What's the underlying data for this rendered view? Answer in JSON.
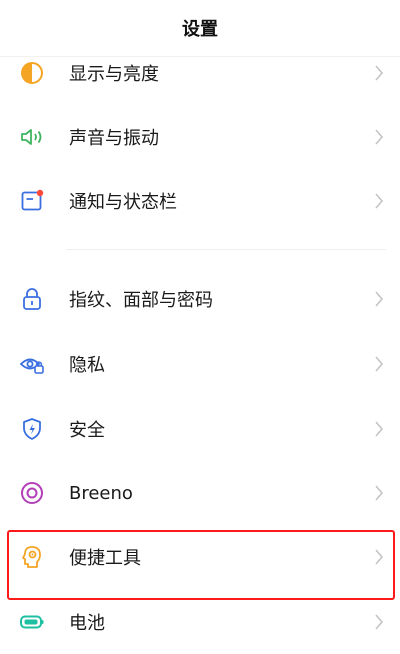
{
  "header": {
    "title": "设置"
  },
  "group1": [
    {
      "label": "显示与亮度",
      "icon": "display-brightness-icon"
    },
    {
      "label": "声音与振动",
      "icon": "sound-vibration-icon"
    },
    {
      "label": "通知与状态栏",
      "icon": "notification-statusbar-icon"
    }
  ],
  "group2": [
    {
      "label": "指纹、面部与密码",
      "icon": "lock-icon"
    },
    {
      "label": "隐私",
      "icon": "privacy-eye-icon"
    },
    {
      "label": "安全",
      "icon": "security-shield-icon"
    },
    {
      "label": "Breeno",
      "icon": "breeno-icon"
    },
    {
      "label": "便捷工具",
      "icon": "convenience-tools-icon"
    },
    {
      "label": "电池",
      "icon": "battery-icon"
    }
  ],
  "colors": {
    "highlight": "#ff1a1a",
    "accent_orange": "#f5a524",
    "accent_green": "#3fb45f",
    "accent_blue": "#3a6fe0",
    "accent_purple": "#b23fb8",
    "accent_teal": "#1fbfa3"
  }
}
